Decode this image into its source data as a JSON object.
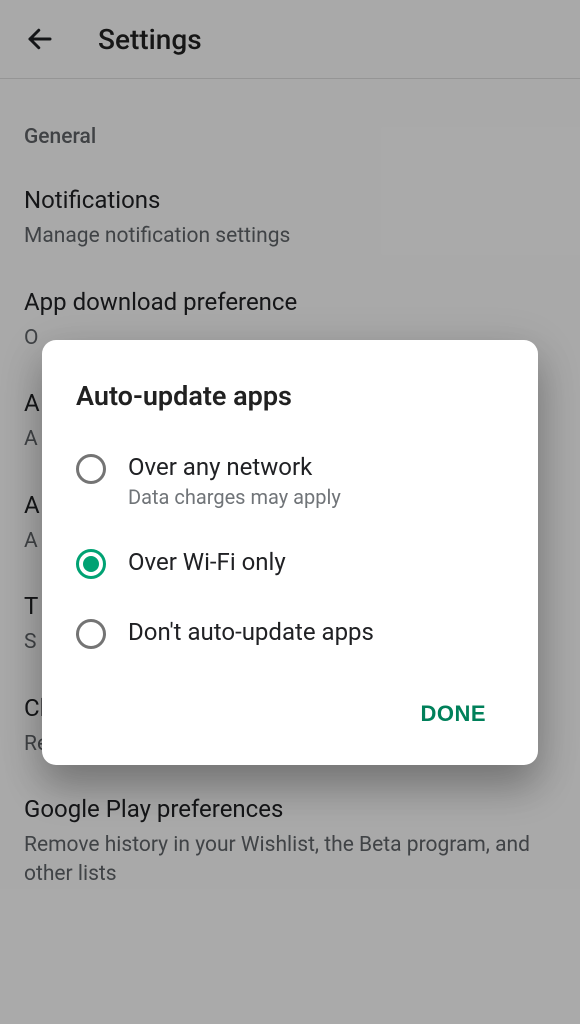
{
  "colors": {
    "accent": "#00a273",
    "accentDark": "#00805a"
  },
  "appbar": {
    "title": "Settings"
  },
  "sections": {
    "generalHeader": "General",
    "items": [
      {
        "title": "Notifications",
        "sub": "Manage notification settings"
      },
      {
        "title": "App download preference",
        "sub": "O"
      },
      {
        "title": "A",
        "sub": "A"
      },
      {
        "title": "A",
        "sub": "A"
      },
      {
        "title": "T",
        "sub": "S"
      },
      {
        "title": "Clear local search history",
        "sub": "Remove searches you have performed from this device"
      },
      {
        "title": "Google Play preferences",
        "sub": "Remove history in your Wishlist, the Beta program, and other lists"
      }
    ]
  },
  "dialog": {
    "title": "Auto-update apps",
    "doneLabel": "DONE",
    "selectedIndex": 1,
    "options": [
      {
        "title": "Over any network",
        "sub": "Data charges may apply"
      },
      {
        "title": "Over Wi-Fi only",
        "sub": ""
      },
      {
        "title": "Don't auto-update apps",
        "sub": ""
      }
    ]
  }
}
